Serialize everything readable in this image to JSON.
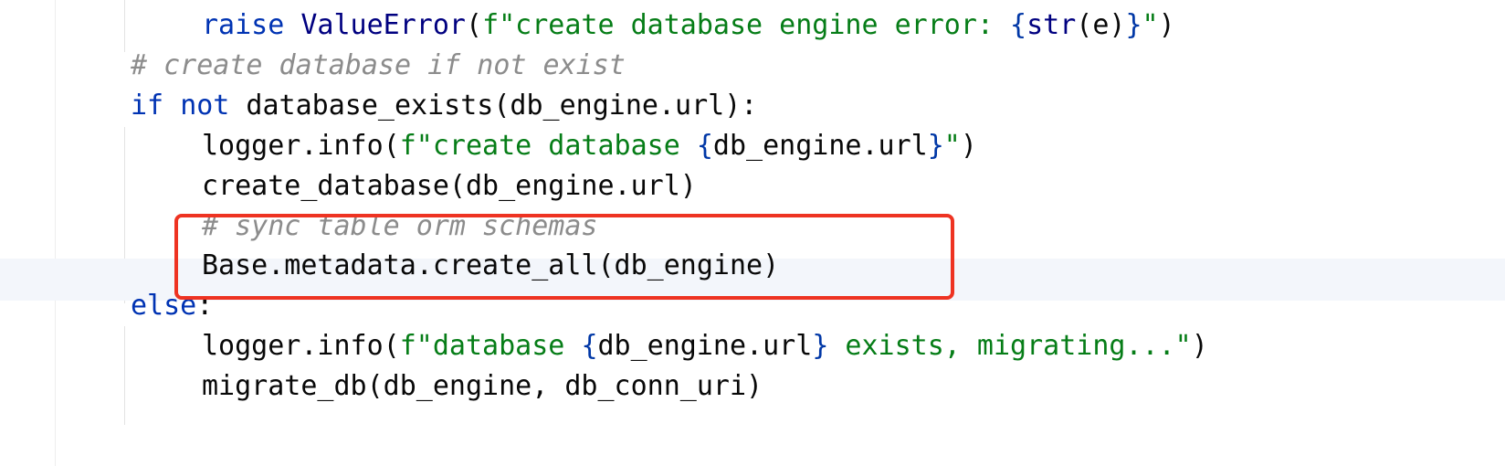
{
  "editor": {
    "language": "python",
    "lines": [
      {
        "indent": 2,
        "tokens": [
          {
            "t": "raise",
            "c": "kw"
          },
          {
            "t": " ",
            "c": "plain"
          },
          {
            "t": "ValueError",
            "c": "cls"
          },
          {
            "t": "(",
            "c": "plain"
          },
          {
            "t": "f\"create database engine error: ",
            "c": "str"
          },
          {
            "t": "{",
            "c": "brace"
          },
          {
            "t": "str",
            "c": "cls"
          },
          {
            "t": "(e)",
            "c": "plain"
          },
          {
            "t": "}",
            "c": "brace"
          },
          {
            "t": "\"",
            "c": "str"
          },
          {
            "t": ")",
            "c": "plain"
          }
        ]
      },
      {
        "indent": 1,
        "tokens": [
          {
            "t": "# create database if not exist",
            "c": "cmt"
          }
        ]
      },
      {
        "indent": 1,
        "tokens": [
          {
            "t": "if",
            "c": "kw"
          },
          {
            "t": " ",
            "c": "plain"
          },
          {
            "t": "not",
            "c": "kw"
          },
          {
            "t": " database_exists(db_engine.url):",
            "c": "plain"
          }
        ]
      },
      {
        "indent": 2,
        "tokens": [
          {
            "t": "logger.info(",
            "c": "plain"
          },
          {
            "t": "f\"create database ",
            "c": "str"
          },
          {
            "t": "{",
            "c": "brace"
          },
          {
            "t": "db_engine.url",
            "c": "plain"
          },
          {
            "t": "}",
            "c": "brace"
          },
          {
            "t": "\"",
            "c": "str"
          },
          {
            "t": ")",
            "c": "plain"
          }
        ]
      },
      {
        "indent": 2,
        "tokens": [
          {
            "t": "create_database(db_engine.url)",
            "c": "plain"
          }
        ]
      },
      {
        "indent": 2,
        "tokens": [
          {
            "t": "# sync table orm schemas",
            "c": "cmt"
          }
        ]
      },
      {
        "indent": 2,
        "current": true,
        "tokens": [
          {
            "t": "Base.metadata.create_all(db_engine)",
            "c": "plain"
          }
        ]
      },
      {
        "indent": 1,
        "tokens": [
          {
            "t": "else",
            "c": "kw"
          },
          {
            "t": ":",
            "c": "plain"
          }
        ]
      },
      {
        "indent": 2,
        "tokens": [
          {
            "t": "logger.info(",
            "c": "plain"
          },
          {
            "t": "f\"database ",
            "c": "str"
          },
          {
            "t": "{",
            "c": "brace"
          },
          {
            "t": "db_engine.url",
            "c": "plain"
          },
          {
            "t": "}",
            "c": "brace"
          },
          {
            "t": " exists, migrating...\"",
            "c": "str"
          },
          {
            "t": ")",
            "c": "plain"
          }
        ]
      },
      {
        "indent": 2,
        "tokens": [
          {
            "t": "migrate_db(db_engine, db_conn_uri)",
            "c": "plain"
          }
        ]
      }
    ]
  },
  "annotation": {
    "color": "#ee3322",
    "highlighted_lines": [
      6,
      7
    ]
  },
  "colors": {
    "keyword": "#0033b3",
    "class": "#000080",
    "string": "#067d17",
    "brace": "#0037a6",
    "comment": "#8c8c8c",
    "text": "#080808",
    "current_line_bg": "#f3f6fb"
  }
}
